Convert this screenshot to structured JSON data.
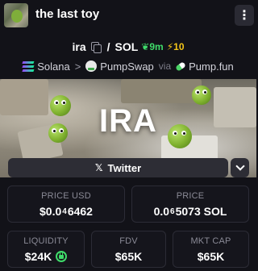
{
  "header": {
    "title": "the last toy",
    "menu_glyph": "⋮"
  },
  "token": {
    "symbol": "ira",
    "quote": "SOL",
    "age": "9m",
    "boost": "10"
  },
  "chain": {
    "network": "Solana",
    "dex": "PumpSwap",
    "via_label": "via",
    "launchpad": "Pump.fun"
  },
  "banner": {
    "text": "IRA"
  },
  "social": {
    "twitter_label": "Twitter"
  },
  "stats": {
    "price_usd": {
      "label": "PRICE USD",
      "prefix": "$0.0",
      "zeros": "4",
      "digits": "6462"
    },
    "price_sol": {
      "label": "PRICE",
      "prefix": "0.0",
      "zeros": "6",
      "digits": "5073 SOL"
    },
    "liquidity": {
      "label": "LIQUIDITY",
      "value": "$24K"
    },
    "fdv": {
      "label": "FDV",
      "value": "$65K"
    },
    "mkt_cap": {
      "label": "MKT CAP",
      "value": "$65K"
    }
  },
  "colors": {
    "background": "#121218",
    "age_green": "#3fdc6a",
    "boost_yellow": "#f3c518",
    "button_bg": "#2d2d35"
  }
}
